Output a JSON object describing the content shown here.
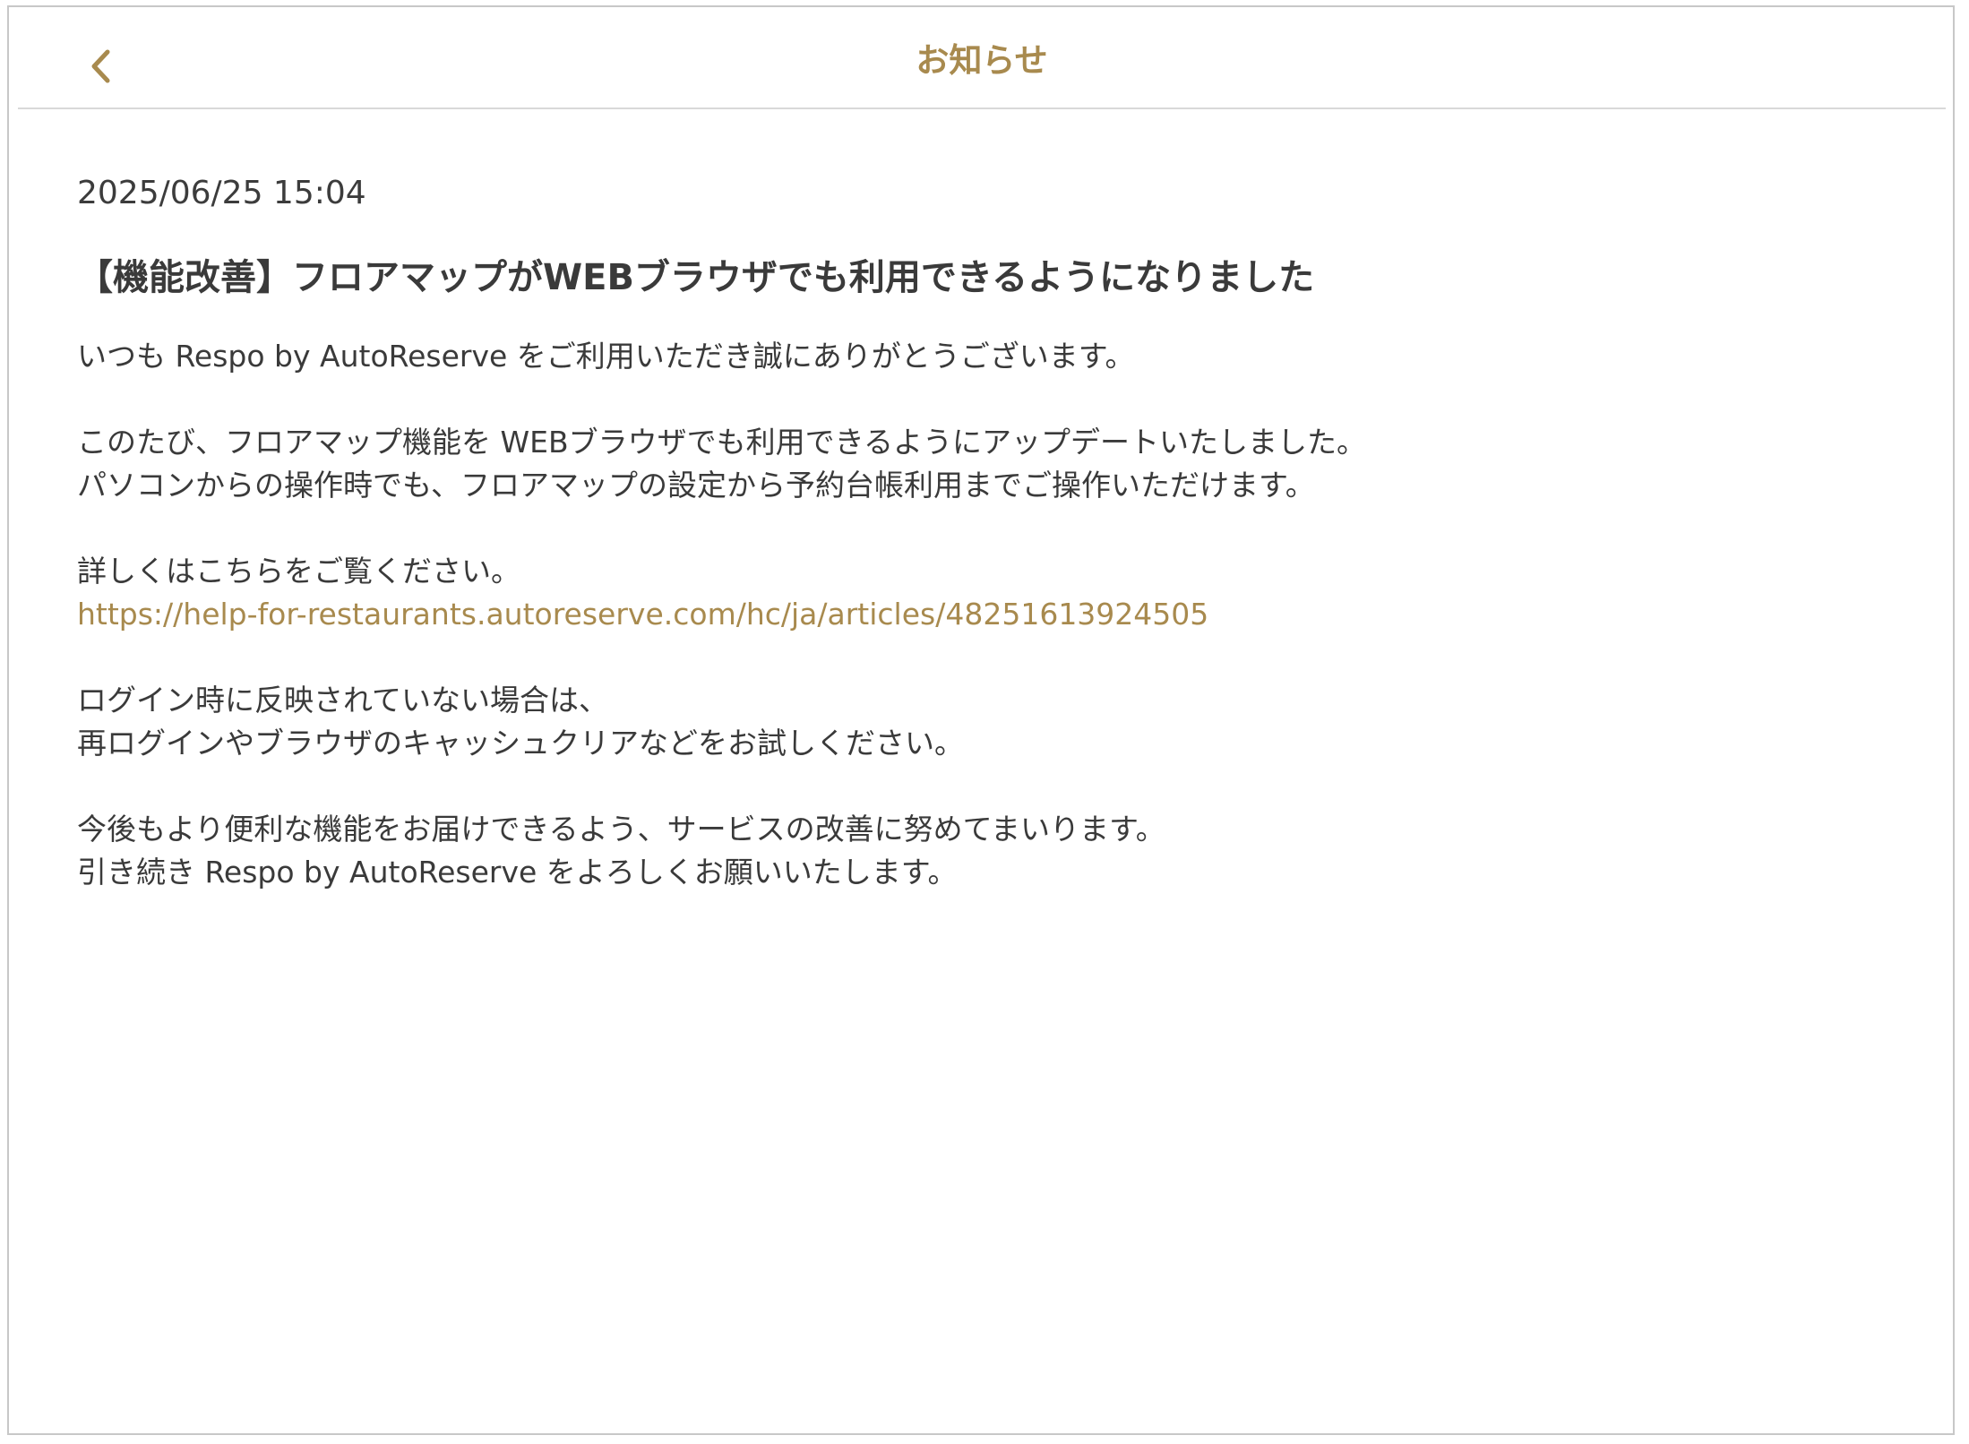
{
  "header": {
    "back_icon": "chevron-left-icon",
    "title": "お知らせ"
  },
  "colors": {
    "accent": "#a88a4e",
    "text": "#333333",
    "divider": "#d9d9d9"
  },
  "notice": {
    "date": "2025/06/25 15:04",
    "title": "【機能改善】フロアマップがWEBブラウザでも利用できるようになりました",
    "greeting": "いつも Respo by AutoReserve をご利用いただき誠にありがとうございます。",
    "body1_line1": "このたび、フロアマップ機能を WEBブラウザでも利用できるようにアップデートいたしました。",
    "body1_line2": "パソコンからの操作時でも、フロアマップの設定から予約台帳利用までご操作いただけます。",
    "details_text": "詳しくはこちらをご覧ください。",
    "details_link": "https://help-for-restaurants.autoreserve.com/hc/ja/articles/48251613924505",
    "login_line1": "ログイン時に反映されていない場合は、",
    "login_line2": "再ログインやブラウザのキャッシュクリアなどをお試しください。",
    "closing_line1": "今後もより便利な機能をお届けできるよう、サービスの改善に努めてまいります。",
    "closing_line2": "引き続き Respo by AutoReserve をよろしくお願いいたします。"
  }
}
